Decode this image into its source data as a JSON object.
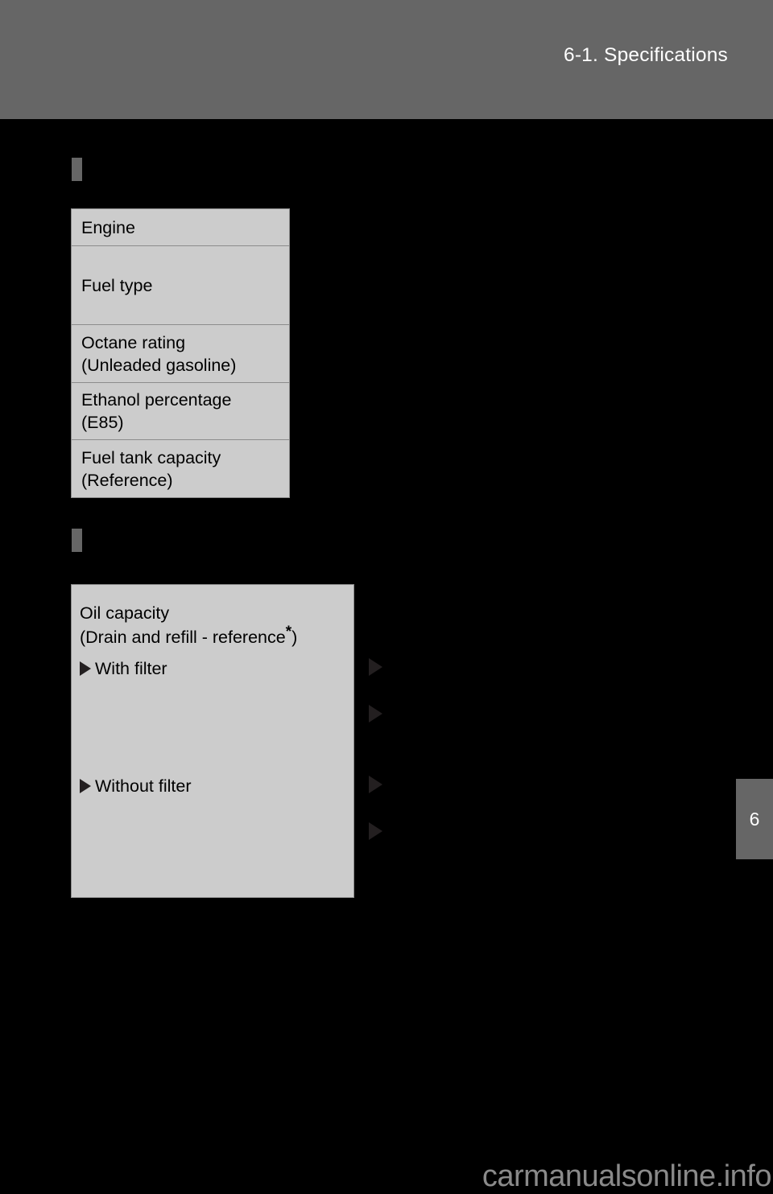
{
  "header": {
    "title": "6-1. Specifications"
  },
  "sections": [
    {
      "name": "fuel-section",
      "marker": "section-marker",
      "table": {
        "rows": [
          {
            "lines": [
              "Engine"
            ]
          },
          {
            "lines": [
              "Fuel type"
            ]
          },
          {
            "lines": [
              "Octane rating",
              "(Unleaded gasoline)"
            ]
          },
          {
            "lines": [
              "Ethanol percentage",
              "(E85)"
            ]
          },
          {
            "lines": [
              "Fuel tank capacity",
              "(Reference)"
            ]
          }
        ]
      }
    },
    {
      "name": "oil-section",
      "marker": "section-marker",
      "table": {
        "heading_line_1": "Oil capacity",
        "heading_line_2_pre": "(Drain and refill - reference",
        "heading_footnote": "*",
        "heading_line_2_post": ")",
        "sub_items": [
          {
            "label": "With filter",
            "icon": "triangle-right-icon"
          },
          {
            "label": "Without filter",
            "icon": "triangle-right-icon"
          }
        ],
        "value_markers": [
          "triangle-right-icon",
          "triangle-right-icon",
          "triangle-right-icon",
          "triangle-right-icon"
        ]
      }
    }
  ],
  "chapter_tab": {
    "number": "6"
  },
  "watermark": {
    "text": "carmanualsonline.info"
  },
  "colors": {
    "page_background": "#000000",
    "header_band": "#666666",
    "table_fill": "#cccccc",
    "table_border": "#8c8c8c",
    "triangle": "#231f20",
    "watermark": "#8a8a8a",
    "header_text": "#ffffff"
  }
}
